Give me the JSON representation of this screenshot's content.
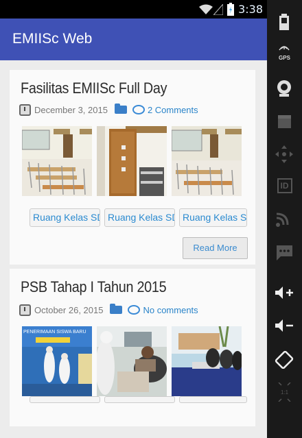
{
  "status": {
    "time": "3:38"
  },
  "app": {
    "title": "EMIISc Web"
  },
  "posts": [
    {
      "title": "Fasilitas EMIISc Full Day",
      "date": "December 3, 2015",
      "comments": "2 Comments",
      "tags": [
        "Ruang Kelas SD",
        "Ruang Kelas SD",
        "Ruang Kelas SD"
      ],
      "read_more": "Read More"
    },
    {
      "title": "PSB Tahap I Tahun 2015",
      "date": "October 26, 2015",
      "comments": "No comments",
      "banner_text": "PENERIMAAN SISWA BARU"
    }
  ],
  "side_panel": {
    "gps_label": "GPS",
    "id_label": "ID",
    "scale_label": "1:1"
  },
  "colors": {
    "app_bar": "#3f51b5",
    "link": "#2a84c9"
  }
}
